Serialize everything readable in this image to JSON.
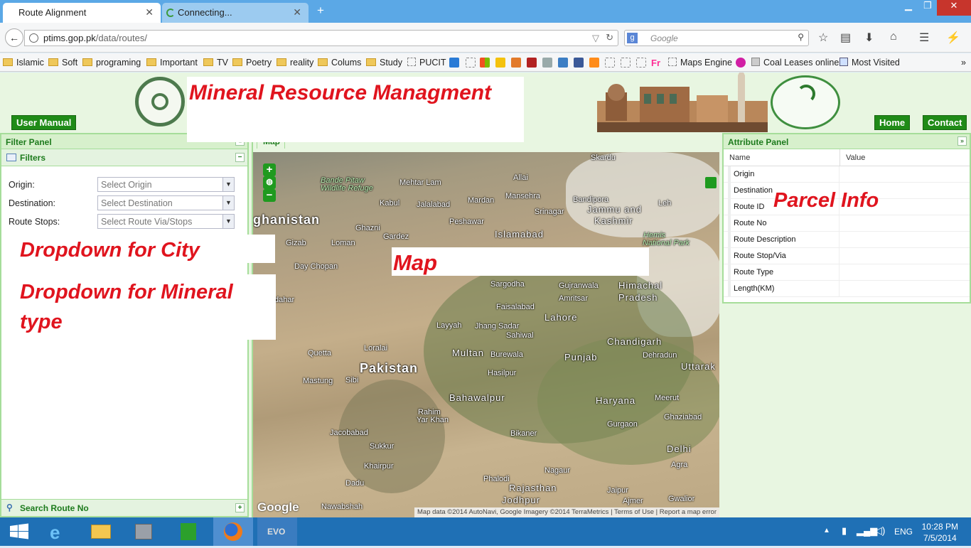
{
  "browser": {
    "tabs": [
      {
        "label": "Route Alignment"
      },
      {
        "label": "Connecting..."
      }
    ],
    "url_domain": "ptims.gop.pk",
    "url_path": "/data/routes/",
    "search_placeholder": "Google",
    "bookmarks": [
      "Islamic",
      "Soft",
      "programing",
      "Important",
      "TV",
      "Poetry",
      "reality",
      "Colums",
      "Study",
      "PUCIT",
      "Maps Engine",
      "Coal Leases online",
      "Most Visited"
    ]
  },
  "site": {
    "title": "Mineral Resource Managment",
    "user_manual": "User Manual",
    "home": "Home",
    "contact": "Contact"
  },
  "filter_panel": {
    "title": "Filter Panel",
    "filters_title": "Filters",
    "origin_label": "Origin:",
    "origin_value": "Select Origin",
    "destination_label": "Destination:",
    "destination_value": "Select Destination",
    "stops_label": "Route Stops:",
    "stops_value": "Select Route Via/Stops",
    "search_route": "Search Route No"
  },
  "annotations": {
    "city": "Dropdown for City",
    "mineral_1": "Dropdown for Mineral",
    "mineral_2": "type",
    "map": "Map",
    "parcel": "Parcel Info"
  },
  "map": {
    "tab": "Map",
    "labels": [
      "Skardu",
      "Bande Pitaw",
      "Wildlife Refuge",
      "Allai",
      "Mehtar Lam",
      "Mansehra",
      "Bandipora",
      "Kabul",
      "Jalalabad",
      "Mardan",
      "Srinagar",
      "Jammu and",
      "Kashmir",
      "Leh",
      "ghanistan",
      "Peshawar",
      "Hemis",
      "National Park",
      "Ghazni",
      "Gardez",
      "Islamabad",
      "Gizab",
      "Loman",
      "Day Chopan",
      "Sargodha",
      "Gujranwala",
      "Himachal",
      "Pradesh",
      "dahar",
      "Faisalabad",
      "Amritsar",
      "Lahore",
      "Layyah",
      "Jhang Sadar",
      "Sahiwal",
      "Chandigarh",
      "Loralai",
      "Multan",
      "Burewala",
      "Dehradun",
      "Quetta",
      "Pakistan",
      "Punjab",
      "Uttarak",
      "Mastung",
      "Sibi",
      "Hasilpur",
      "Bahawalpur",
      "Haryana",
      "Meerut",
      "Ghaziabad",
      "Rahim",
      "Yar Khan",
      "Gurgaon",
      "Jacobabad",
      "Bikaner",
      "Delhi",
      "Sukkur",
      "Khairpur",
      "Agra",
      "Nagaur",
      "Dadu",
      "Phalodi",
      "Rajasthan",
      "Jaipur",
      "Nawabshah",
      "Jodhpur",
      "Ajmer",
      "Gwalior"
    ],
    "google": "Google",
    "credit": "Map data ©2014 AutoNavi, Google Imagery ©2014 TerraMetrics",
    "terms": "Terms of Use",
    "report": "Report a map error"
  },
  "attribute_panel": {
    "title": "Attribute Panel",
    "col_name": "Name",
    "col_value": "Value",
    "rows": [
      "Origin",
      "Destination",
      "Route ID",
      "Route No",
      "Route Description",
      "Route Stop/Via",
      "Route Type",
      "Length(KM)"
    ]
  },
  "taskbar": {
    "lang": "ENG",
    "time": "10:28 PM",
    "date": "7/5/2014"
  },
  "colors": {
    "accent_green": "#1f8b17",
    "panel_border": "#a6dd9a",
    "annotation_red": "#e0141e",
    "taskbar_blue": "#1f70b5"
  }
}
